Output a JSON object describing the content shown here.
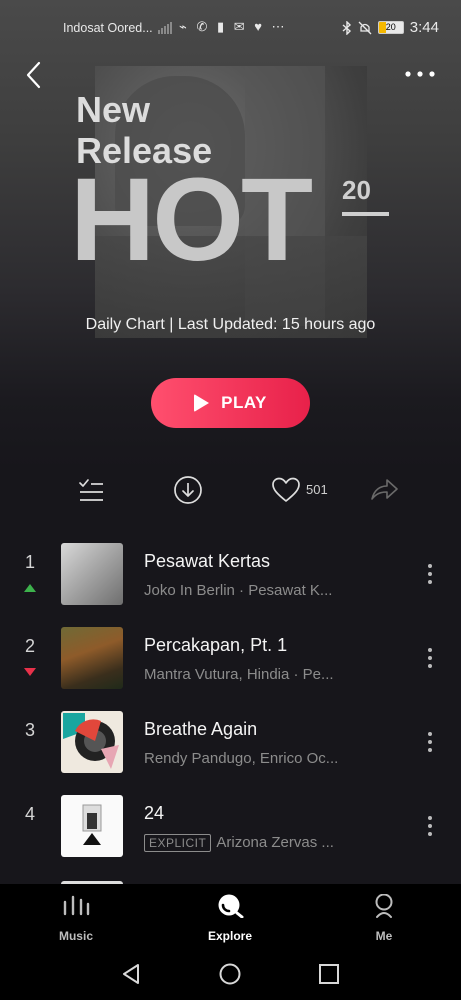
{
  "status_bar": {
    "carrier": "Indosat Oored...",
    "notification_icons": "⌁ ✆ ▮ ✉ ♥ ⋯",
    "battery_level": "20",
    "time": "3:44"
  },
  "header": {
    "title_line1": "New",
    "title_line2": "Release",
    "title_big": "HOT",
    "title_number": "20",
    "subtitle": "Daily Chart | Last Updated: 15 hours ago"
  },
  "play_button": {
    "label": "PLAY"
  },
  "actions": {
    "like_count": "501"
  },
  "songs": [
    {
      "rank": "1",
      "trend": "up",
      "title": "Pesawat Kertas",
      "subtitle": "Joko In Berlin · Pesawat K...",
      "explicit": ""
    },
    {
      "rank": "2",
      "trend": "down",
      "title": "Percakapan, Pt. 1",
      "subtitle": "Mantra Vutura, Hindia · Pe...",
      "explicit": ""
    },
    {
      "rank": "3",
      "trend": "",
      "title": "Breathe Again",
      "subtitle": "Rendy Pandugo, Enrico Oc...",
      "explicit": ""
    },
    {
      "rank": "4",
      "trend": "",
      "title": "24",
      "subtitle": "Arizona Zervas ...",
      "explicit": "EXPLICIT"
    }
  ],
  "tabs": [
    {
      "label": "Music",
      "icon": "music-bars-icon"
    },
    {
      "label": "Explore",
      "icon": "explore-icon",
      "active": true
    },
    {
      "label": "Me",
      "icon": "person-icon"
    }
  ],
  "colors": {
    "accent_start": "#ff4f6e",
    "accent_end": "#e8214a",
    "trend_up": "#3db24c",
    "trend_down": "#e8314a",
    "background": "#17161b"
  }
}
